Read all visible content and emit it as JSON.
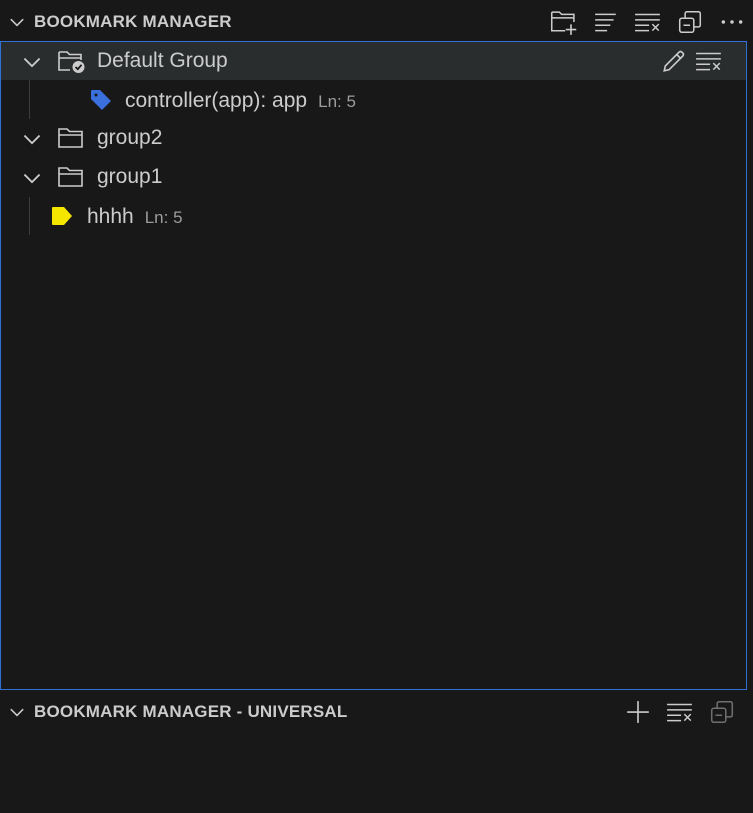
{
  "panel1": {
    "title": "BOOKMARK MANAGER",
    "actions": [
      "new-folder-icon",
      "list-icon",
      "clear-all-icon",
      "collapse-all-icon",
      "more-icon"
    ]
  },
  "tree": {
    "groups": [
      {
        "label": "Default Group",
        "active": true,
        "expanded": true,
        "row_actions": [
          "edit-icon",
          "clear-all-icon"
        ],
        "bookmarks": [
          {
            "label": "controller(app): app",
            "desc": "Ln: 5",
            "tag_color": "#3a6fdc"
          }
        ]
      },
      {
        "label": "group2",
        "expanded": true,
        "bookmarks": []
      },
      {
        "label": "group1",
        "expanded": true,
        "bookmarks": []
      }
    ],
    "loose_bookmarks": [
      {
        "label": "hhhh",
        "desc": "Ln: 5",
        "tag_color": "#f5e600"
      }
    ]
  },
  "panel2": {
    "title": "BOOKMARK MANAGER - UNIVERSAL",
    "actions": [
      "add-icon",
      "clear-all-icon",
      "collapse-all-icon"
    ]
  },
  "colors": {
    "background": "#181818",
    "focus_border": "#2f6fd6",
    "selected_row": "#2a2d2e",
    "text": "#cccccc",
    "muted": "#9d9d9d"
  }
}
